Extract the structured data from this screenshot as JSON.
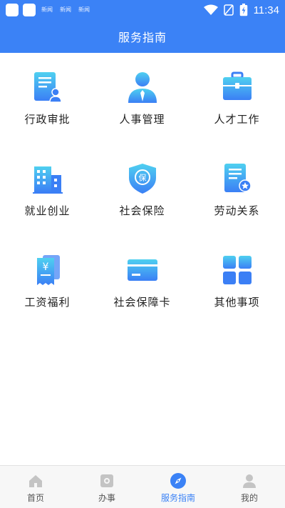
{
  "status_bar": {
    "notifications": [
      "新闻",
      "新闻",
      "新闻"
    ],
    "time": "11:34",
    "battery_icon": "battery-icon",
    "wifi_icon": "wifi-icon",
    "signal_icon": "no-signal-icon"
  },
  "header": {
    "title": "服务指南"
  },
  "services": [
    {
      "label": "行政审批",
      "icon": "document-user-icon"
    },
    {
      "label": "人事管理",
      "icon": "person-tie-icon"
    },
    {
      "label": "人才工作",
      "icon": "briefcase-icon"
    },
    {
      "label": "就业创业",
      "icon": "buildings-icon"
    },
    {
      "label": "社会保险",
      "icon": "shield-bao-icon"
    },
    {
      "label": "劳动关系",
      "icon": "certificate-icon"
    },
    {
      "label": "工资福利",
      "icon": "yuan-receipt-icon"
    },
    {
      "label": "社会保障卡",
      "icon": "card-icon"
    },
    {
      "label": "其他事项",
      "icon": "grid-squares-icon"
    }
  ],
  "bottom_nav": {
    "items": [
      {
        "label": "首页",
        "icon": "home-icon",
        "active": false
      },
      {
        "label": "办事",
        "icon": "camera-frame-icon",
        "active": false
      },
      {
        "label": "服务指南",
        "icon": "compass-icon",
        "active": true
      },
      {
        "label": "我的",
        "icon": "person-icon",
        "active": false
      }
    ]
  },
  "colors": {
    "primary": "#3b82f6",
    "icon_gradient_top": "#4fd0f0",
    "icon_gradient_bottom": "#3b7ff5",
    "text": "#222222",
    "nav_inactive": "#bbbbbb"
  }
}
